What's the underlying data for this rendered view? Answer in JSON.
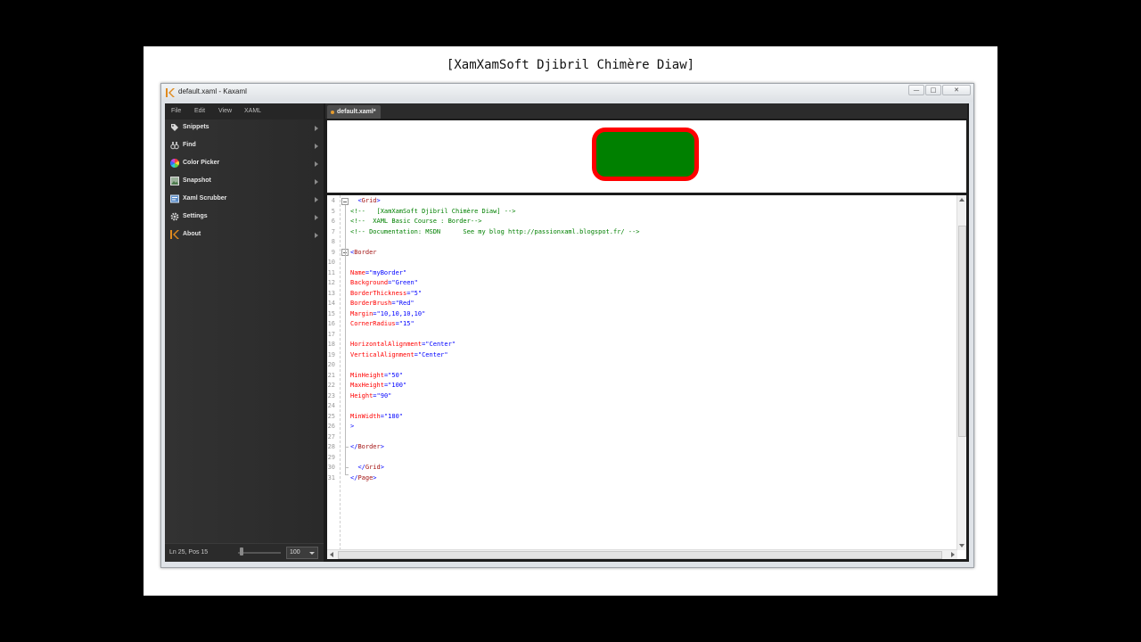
{
  "slide": {
    "title": "[XamXamSoft Djibril Chimère Diaw]"
  },
  "window": {
    "title": "default.xaml - Kaxaml",
    "controls": [
      "minimize-icon",
      "maximize-icon",
      "close-icon"
    ]
  },
  "menu": [
    "File",
    "Edit",
    "View",
    "XAML"
  ],
  "sidebar": {
    "items": [
      {
        "label": "Snippets",
        "icon": "tag-icon"
      },
      {
        "label": "Find",
        "icon": "binoculars-icon"
      },
      {
        "label": "Color Picker",
        "icon": "color-wheel-icon"
      },
      {
        "label": "Snapshot",
        "icon": "picture-icon"
      },
      {
        "label": "Xaml Scrubber",
        "icon": "scrubber-icon"
      },
      {
        "label": "Settings",
        "icon": "gear-icon"
      },
      {
        "label": "About",
        "icon": "kaxaml-logo-icon"
      }
    ]
  },
  "status": {
    "position": "Ln 25, Pos 15",
    "zoom": "100"
  },
  "tab": {
    "label": "default.xaml*"
  },
  "preview": {
    "background": "#008000",
    "border_brush": "#ff0000"
  },
  "editor": {
    "line_numbers": [
      "4",
      "5",
      "6",
      "7",
      "8",
      "9",
      "10",
      "11",
      "12",
      "13",
      "14",
      "15",
      "16",
      "17",
      "18",
      "19",
      "20",
      "21",
      "22",
      "23",
      "24",
      "25",
      "26",
      "27",
      "28",
      "29",
      "30",
      "31"
    ],
    "lines": [
      {
        "indent": "  ",
        "tokens": [
          [
            "ang",
            "<"
          ],
          [
            "tag",
            "Grid"
          ],
          [
            "ang",
            ">"
          ]
        ]
      },
      {
        "indent": "",
        "tokens": [
          [
            "comment",
            "<!--   [XamXamSoft Djibril Chimère Diaw] -->"
          ]
        ]
      },
      {
        "indent": "",
        "tokens": [
          [
            "comment",
            "<!--  XAML Basic Course : Border-->"
          ]
        ]
      },
      {
        "indent": "",
        "tokens": [
          [
            "comment",
            "<!-- Documentation: MSDN      See my blog http://passionxaml.blogspot.fr/ -->"
          ]
        ]
      },
      {
        "indent": "",
        "tokens": []
      },
      {
        "indent": "",
        "tokens": [
          [
            "ang",
            "<"
          ],
          [
            "tag",
            "Border"
          ]
        ]
      },
      {
        "indent": "",
        "tokens": []
      },
      {
        "indent": "",
        "tokens": [
          [
            "attr",
            "Name"
          ],
          [
            "ang",
            "="
          ],
          [
            "val",
            "\"myBorder\""
          ]
        ]
      },
      {
        "indent": "",
        "tokens": [
          [
            "attr",
            "Background"
          ],
          [
            "ang",
            "="
          ],
          [
            "val",
            "\"Green\""
          ]
        ]
      },
      {
        "indent": "",
        "tokens": [
          [
            "attr",
            "BorderThickness"
          ],
          [
            "ang",
            "="
          ],
          [
            "val",
            "\"5\""
          ]
        ]
      },
      {
        "indent": "",
        "tokens": [
          [
            "attr",
            "BorderBrush"
          ],
          [
            "ang",
            "="
          ],
          [
            "val",
            "\"Red\""
          ]
        ]
      },
      {
        "indent": "",
        "tokens": [
          [
            "attr",
            "Margin"
          ],
          [
            "ang",
            "="
          ],
          [
            "val",
            "\"10,10,10,10\""
          ]
        ]
      },
      {
        "indent": "",
        "tokens": [
          [
            "attr",
            "CornerRadius"
          ],
          [
            "ang",
            "="
          ],
          [
            "val",
            "\"15\""
          ]
        ]
      },
      {
        "indent": "",
        "tokens": []
      },
      {
        "indent": "",
        "tokens": [
          [
            "attr",
            "HorizontalAlignment"
          ],
          [
            "ang",
            "="
          ],
          [
            "val",
            "\"Center\""
          ]
        ]
      },
      {
        "indent": "",
        "tokens": [
          [
            "attr",
            "VerticalAlignment"
          ],
          [
            "ang",
            "="
          ],
          [
            "val",
            "\"Center\""
          ]
        ]
      },
      {
        "indent": "",
        "tokens": []
      },
      {
        "indent": "",
        "tokens": [
          [
            "attr",
            "MinHeight"
          ],
          [
            "ang",
            "="
          ],
          [
            "val",
            "\"50\""
          ]
        ]
      },
      {
        "indent": "",
        "tokens": [
          [
            "attr",
            "MaxHeight"
          ],
          [
            "ang",
            "="
          ],
          [
            "val",
            "\"100\""
          ]
        ]
      },
      {
        "indent": "",
        "tokens": [
          [
            "attr",
            "Height"
          ],
          [
            "ang",
            "="
          ],
          [
            "val",
            "\"90\""
          ]
        ]
      },
      {
        "indent": "",
        "tokens": []
      },
      {
        "indent": "",
        "tokens": [
          [
            "attr",
            "MinWidth"
          ],
          [
            "ang",
            "="
          ],
          [
            "val",
            "\"180\""
          ]
        ]
      },
      {
        "indent": "",
        "tokens": [
          [
            "ang",
            ">"
          ]
        ]
      },
      {
        "indent": "",
        "tokens": []
      },
      {
        "indent": "",
        "tokens": [
          [
            "ang",
            "</"
          ],
          [
            "tag",
            "Border"
          ],
          [
            "ang",
            ">"
          ]
        ]
      },
      {
        "indent": "",
        "tokens": []
      },
      {
        "indent": "  ",
        "tokens": [
          [
            "ang",
            "</"
          ],
          [
            "tag",
            "Grid"
          ],
          [
            "ang",
            ">"
          ]
        ]
      },
      {
        "indent": "",
        "tokens": [
          [
            "ang",
            "</"
          ],
          [
            "tag",
            "Page"
          ],
          [
            "ang",
            ">"
          ]
        ]
      }
    ]
  }
}
